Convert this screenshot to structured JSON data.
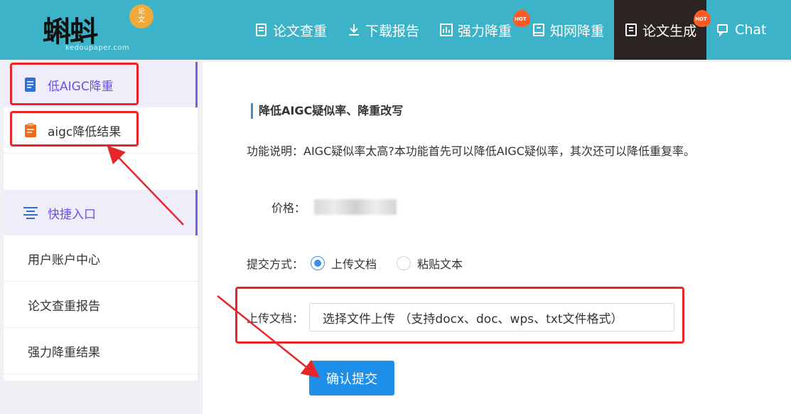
{
  "brand": {
    "logo_text": "蝌蚪",
    "badge_line1": "论",
    "badge_line2": "文",
    "domain": "kedoupaper.com"
  },
  "nav": {
    "items": [
      {
        "label": "论文查重",
        "icon": "document-icon",
        "hot": false,
        "active": false
      },
      {
        "label": "下载报告",
        "icon": "download-icon",
        "hot": false,
        "active": false
      },
      {
        "label": "强力降重",
        "icon": "grid-chart-icon",
        "hot": true,
        "active": false
      },
      {
        "label": "知网降重",
        "icon": "book-icon",
        "hot": false,
        "active": false
      },
      {
        "label": "论文生成",
        "icon": "write-icon",
        "hot": true,
        "active": true
      },
      {
        "label": "Chat",
        "icon": "chat-icon",
        "hot": false,
        "active": false
      }
    ],
    "hot_label": "HOT"
  },
  "sidebar": {
    "section1_title": "低AIGC降重",
    "section1_items": [
      "aigc降低结果"
    ],
    "section2_title": "快捷入口",
    "section2_items": [
      "用户账户中心",
      "论文查重报告",
      "强力降重结果"
    ]
  },
  "main": {
    "title": "降低AIGC疑似率、降重改写",
    "desc_label": "功能说明：",
    "desc_text": "AIGC疑似率太高?本功能首先可以降低AIGC疑似率，其次还可以降低重复率。",
    "price_label": "价格：",
    "submit_label": "提交方式：",
    "radio_upload": "上传文档",
    "radio_paste": "粘贴文本",
    "upload_label": "上传文档：",
    "upload_placeholder": "选择文件上传 （支持docx、doc、wps、txt文件格式）",
    "confirm_label": "确认提交"
  },
  "colors": {
    "header": "#3cb3c9",
    "active_nav": "#2c2323",
    "accent_purple": "#6a4fe0",
    "button_blue": "#1e8fe8",
    "annotation_red": "#e8262a"
  }
}
